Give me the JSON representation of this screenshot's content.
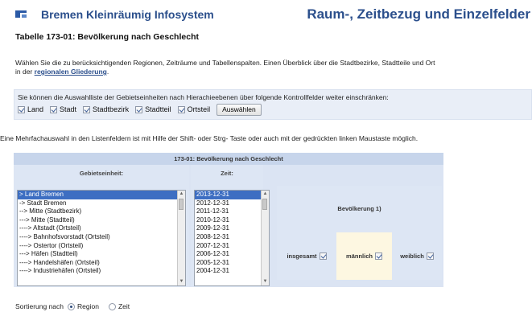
{
  "header": {
    "brand": "Bremen Kleinräumig Infosystem",
    "section_title": "Raum-, Zeitbezug und Einzelfelder"
  },
  "table_title": "Tabelle 173-01: Bevölkerung nach Geschlecht",
  "intro": {
    "text": "Wählen Sie die zu berücksichtigenden Regionen, Zeiträume und Tabellenspalten. Einen Überblick über die Stadtbezirke, Stadtteile und Ort",
    "text2": "in der",
    "link": "regionalen Gliederung",
    "text3": "."
  },
  "filter": {
    "text": "Sie können die Auswahlliste der Gebietseinheiten nach Hierachieebenen über folgende Kontrollfelder weiter einschränken:",
    "items": [
      {
        "label": "Land",
        "checked": true
      },
      {
        "label": "Stadt",
        "checked": true
      },
      {
        "label": "Stadtbezirk",
        "checked": true
      },
      {
        "label": "Stadtteil",
        "checked": true
      },
      {
        "label": "Ortsteil",
        "checked": true
      }
    ],
    "button_label": "Auswählen"
  },
  "multiselect_note": "Eine Mehrfachauswahl in den Listenfeldern ist mit Hilfe der Shift- oder Strg- Taste oder auch mit der gedrückten linken Maustaste möglich.",
  "datatable": {
    "title": "173-01: Bevölkerung nach Geschlecht",
    "gebiet_header": "Gebietseinheit:",
    "zeit_header": "Zeit:",
    "bev_header": "Bevölkerung 1)",
    "gebiet_options": [
      "> Land Bremen",
      "-> Stadt Bremen",
      "--> Mitte (Stadtbezirk)",
      "---> Mitte (Stadtteil)",
      "----> Altstadt (Ortsteil)",
      "----> Bahnhofsvorstadt (Ortsteil)",
      "----> Ostertor (Ortsteil)",
      "---> Häfen (Stadtteil)",
      "----> Handelshäfen (Ortsteil)",
      "----> Industriehäfen (Ortsteil)"
    ],
    "gebiet_selected": 0,
    "zeit_options": [
      "2013-12-31",
      "2012-12-31",
      "2011-12-31",
      "2010-12-31",
      "2009-12-31",
      "2008-12-31",
      "2007-12-31",
      "2006-12-31",
      "2005-12-31",
      "2004-12-31"
    ],
    "zeit_selected": 0,
    "columns": [
      {
        "label": "insgesamt",
        "checked": true
      },
      {
        "label": "männlich",
        "checked": true
      },
      {
        "label": "weiblich",
        "checked": true
      }
    ]
  },
  "sort": {
    "label": "Sortierung nach",
    "options": [
      {
        "label": "Region",
        "selected": true
      },
      {
        "label": "Zeit",
        "selected": false
      }
    ]
  }
}
